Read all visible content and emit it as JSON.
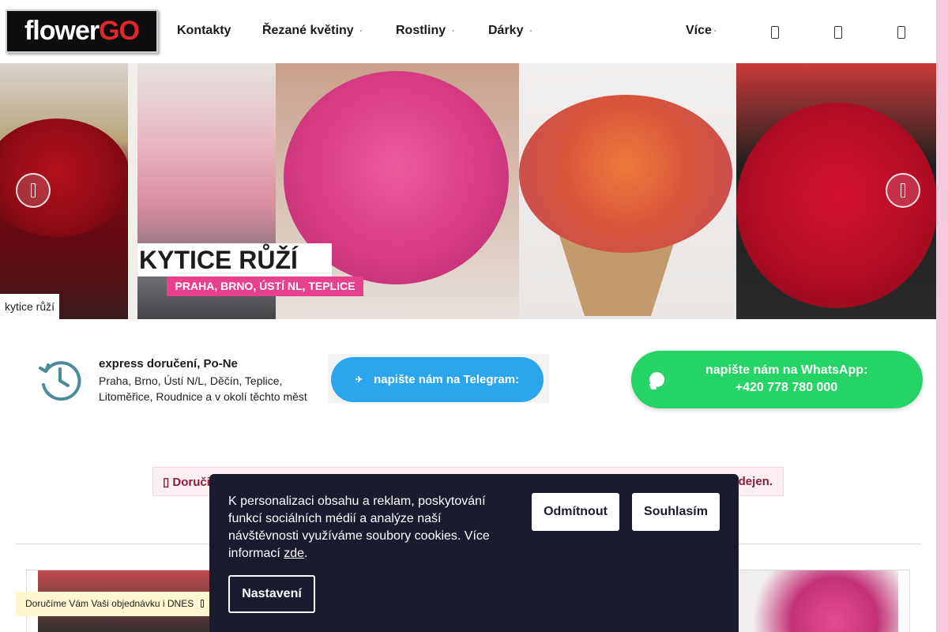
{
  "header": {
    "logo": {
      "part1": "flower",
      "part2": "GO"
    },
    "nav": [
      {
        "label": "Kontakty",
        "has_dropdown": false
      },
      {
        "label": "Řezané květiny",
        "has_dropdown": true
      },
      {
        "label": "Rostliny",
        "has_dropdown": true
      },
      {
        "label": "Dárky",
        "has_dropdown": true
      },
      {
        "label": "Více",
        "has_dropdown": true
      }
    ],
    "icons": [
      "search-icon",
      "user-icon",
      "cart-icon"
    ]
  },
  "hero": {
    "title": "KYTICE RŮŽÍ",
    "subtitle": "PRAHA, BRNO, ÚSTÍ NL, TEPLICE",
    "slide_label": "kytice růží",
    "prev_icon": "chevron-left-icon",
    "next_icon": "chevron-right-icon"
  },
  "delivery": {
    "icon": "clock-history-icon",
    "title": "express doručení, Po-Ne",
    "text": "Praha, Brno, Ústí N/L, Děčín, Teplice, Litoměřice, Roudnice a v okolí těchto měst"
  },
  "telegram": {
    "icon": "paper-plane-icon",
    "label": "napište nám na Telegram:"
  },
  "whatsapp": {
    "icon": "chat-bubble-icon",
    "line1": "napište nám na WhatsApp:",
    "line2": "+420 778 780 000"
  },
  "notice": {
    "left": "Doruči",
    "right": "dejen."
  },
  "bottom_bar": {
    "label": "Doručíme Vám Vaši objednávku i DNES"
  },
  "cookie": {
    "text": "K personalizaci obsahu a reklam, poskytování funkcí sociálních médií a analýze naší návštěvnosti využíváme soubory cookies. Více informací ",
    "link": "zde",
    "text_end": ".",
    "decline": "Odmítnout",
    "accept": "Souhlasím",
    "settings": "Nastavení"
  },
  "colors": {
    "telegram": "#2aa5ee",
    "whatsapp": "#25d366",
    "hero_subtitle_bg": "#e7418d",
    "cookie_bg": "#1b1b2f",
    "notice_text": "#8a1c3c"
  }
}
